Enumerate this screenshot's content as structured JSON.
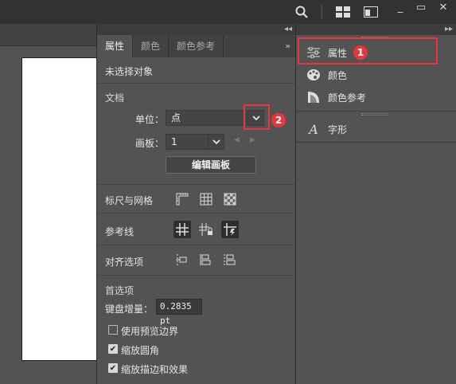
{
  "window_controls": {
    "minimize": "_",
    "restore": "▭",
    "close": "✕"
  },
  "toolbar": {
    "search_icon": "search-icon",
    "workspace_icon": "workspace-icon",
    "panel_icon": "panel-layout-icon"
  },
  "properties_panel": {
    "tabs": [
      {
        "label": "属性",
        "active": true
      },
      {
        "label": "颜色",
        "active": false
      },
      {
        "label": "颜色参考",
        "active": false
      }
    ],
    "more": "»",
    "no_selection": "未选择对象",
    "document": {
      "heading": "文档",
      "unit_label": "单位：",
      "unit_value": "点",
      "artboard_label": "画板：",
      "artboard_value": "1",
      "edit_artboard_button": "编辑画板"
    },
    "rulers": {
      "heading": "标尺与网格"
    },
    "guides": {
      "heading": "参考线"
    },
    "align": {
      "heading": "对齐选项"
    },
    "preferences": {
      "heading": "首选项",
      "keyboard_increment_label": "键盘增量：",
      "keyboard_increment_value": "0.2835 pt",
      "checkboxes": [
        {
          "label": "使用预览边界",
          "checked": false
        },
        {
          "label": "缩放圆角",
          "checked": true
        },
        {
          "label": "缩放描边和效果",
          "checked": true
        }
      ]
    }
  },
  "right_panel": {
    "items": [
      {
        "label": "属性",
        "icon": "properties-icon"
      },
      {
        "label": "颜色",
        "icon": "color-palette-icon"
      },
      {
        "label": "颜色参考",
        "icon": "color-guide-icon"
      },
      {
        "label": "字形",
        "icon": "glyphs-icon"
      }
    ]
  },
  "annotations": {
    "marker_1": "1",
    "marker_2": "2",
    "color": "#e8363c"
  }
}
